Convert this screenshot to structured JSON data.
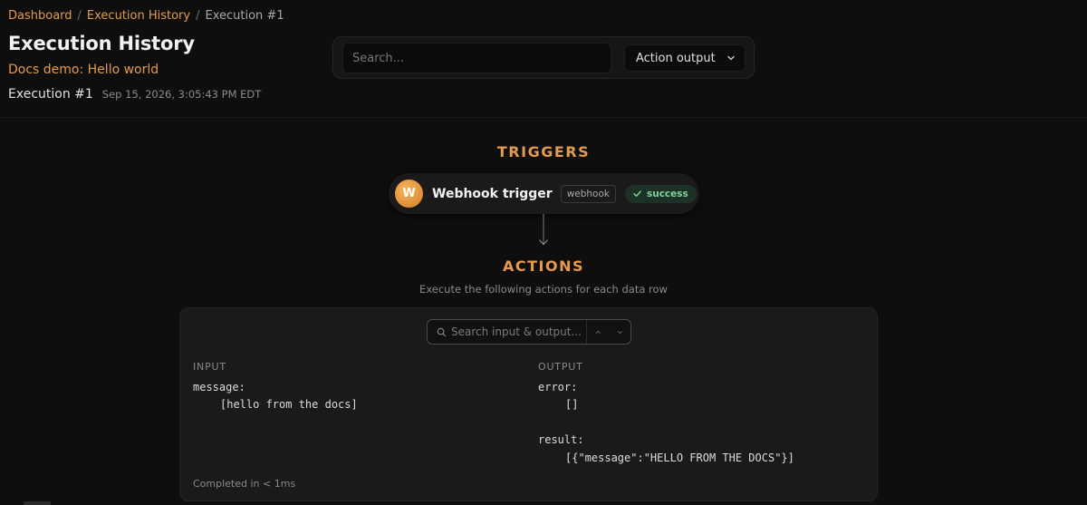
{
  "breadcrumb": {
    "items": [
      "Dashboard",
      "Execution History",
      "Execution #1"
    ],
    "separator": "/"
  },
  "header": {
    "title": "Execution History",
    "workflow_name": "Docs demo: Hello world",
    "execution_name": "Execution #1",
    "execution_date": "Sep 15, 2026, 3:05:43 PM EDT"
  },
  "filter": {
    "search_placeholder": "Search...",
    "view_select": "Action output"
  },
  "triggers": {
    "heading": "TRIGGERS",
    "item": {
      "avatar_letter": "W",
      "name": "Webhook trigger",
      "type": "webhook",
      "status": "success"
    }
  },
  "actions": {
    "heading": "ACTIONS",
    "subtitle": "Execute the following actions for each data row",
    "search_placeholder": "Search input & output...",
    "input_label": "INPUT",
    "output_label": "OUTPUT",
    "input_key": "message:",
    "input_value": "[hello from the docs]",
    "output_error_key": "error:",
    "output_error_value": "[]",
    "output_result_key": "result:",
    "output_result_value": "[{\"message\":\"HELLO FROM THE DOCS\"}]",
    "completed": "Completed in < 1ms"
  },
  "colors": {
    "accent": "#e59a4c",
    "success": "#7ed39a",
    "background": "#0e0e0e",
    "card": "#1a1a1a"
  },
  "icons": {
    "trigger_status": "check-icon",
    "connector": "arrow-down-icon",
    "select": "chevron-down-icon",
    "search": "search-icon",
    "nav_prev": "chevron-up-icon",
    "nav_next": "chevron-down-icon"
  }
}
